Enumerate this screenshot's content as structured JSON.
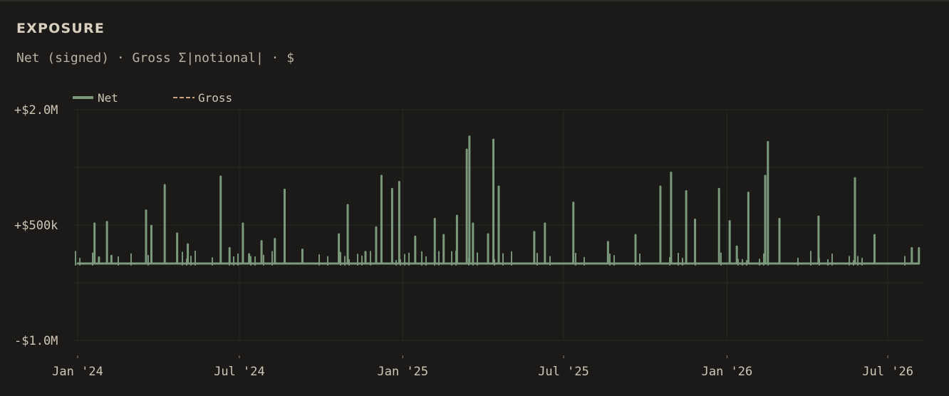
{
  "panel": {
    "title": "EXPOSURE",
    "subtitle": "Net (signed) · Gross Σ|notional| · $"
  },
  "colors": {
    "background": "#1b1a18",
    "grid": "#2a2926",
    "net": "#7b9a7c",
    "gross": "#c9a77a",
    "text": "#cfc6b6"
  },
  "chart_data": {
    "type": "line",
    "title": "EXPOSURE",
    "subtitle": "Net (signed) · Gross Σ|notional| · $",
    "legend": {
      "position": "top-left",
      "entries": [
        {
          "name": "Net",
          "style": "solid",
          "color": "#7b9a7c"
        },
        {
          "name": "Gross",
          "style": "dashed",
          "color": "#c9a77a"
        }
      ]
    },
    "y_ticks": [
      {
        "value": 2000000,
        "label": "+$2.0M"
      },
      {
        "value": 500000,
        "label": "+$500k"
      },
      {
        "value": -1000000,
        "label": "-$1.0M"
      }
    ],
    "x_ticks": [
      {
        "value": "2024-01-01",
        "label": "Jan '24"
      },
      {
        "value": "2024-07-01",
        "label": "Jul '24"
      },
      {
        "value": "2025-01-01",
        "label": "Jan '25"
      },
      {
        "value": "2025-07-01",
        "label": "Jul '25"
      },
      {
        "value": "2026-01-01",
        "label": "Jan '26"
      },
      {
        "value": "2026-07-01",
        "label": "Jul '26"
      }
    ],
    "xlim": [
      "2023-12-28",
      "2026-08-10"
    ],
    "ylim": [
      -1100000,
      2100000
    ],
    "grid": true,
    "baseline": 0,
    "series": [
      {
        "name": "Net",
        "points": [
          [
            "2024-01-01",
            0
          ],
          [
            "2024-01-20",
            520000
          ],
          [
            "2024-01-25",
            80000
          ],
          [
            "2024-02-03",
            540000
          ],
          [
            "2024-02-08",
            100000
          ],
          [
            "2024-03-18",
            690000
          ],
          [
            "2024-03-24",
            490000
          ],
          [
            "2024-04-08",
            1020000
          ],
          [
            "2024-04-22",
            390000
          ],
          [
            "2024-05-04",
            250000
          ],
          [
            "2024-06-10",
            1130000
          ],
          [
            "2024-06-20",
            200000
          ],
          [
            "2024-07-05",
            520000
          ],
          [
            "2024-07-12",
            120000
          ],
          [
            "2024-07-26",
            290000
          ],
          [
            "2024-08-10",
            320000
          ],
          [
            "2024-08-21",
            960000
          ],
          [
            "2024-09-10",
            180000
          ],
          [
            "2024-10-21",
            380000
          ],
          [
            "2024-10-31",
            760000
          ],
          [
            "2024-11-20",
            150000
          ],
          [
            "2024-12-02",
            470000
          ],
          [
            "2024-12-08",
            1140000
          ],
          [
            "2024-12-20",
            970000
          ],
          [
            "2024-12-28",
            1060000
          ],
          [
            "2025-01-15",
            350000
          ],
          [
            "2025-02-06",
            580000
          ],
          [
            "2025-02-16",
            370000
          ],
          [
            "2025-03-03",
            620000
          ],
          [
            "2025-03-14",
            1480000
          ],
          [
            "2025-03-17",
            1650000
          ],
          [
            "2025-03-21",
            520000
          ],
          [
            "2025-04-07",
            380000
          ],
          [
            "2025-04-13",
            1610000
          ],
          [
            "2025-04-19",
            1000000
          ],
          [
            "2025-05-29",
            410000
          ],
          [
            "2025-06-10",
            520000
          ],
          [
            "2025-07-12",
            790000
          ],
          [
            "2025-08-20",
            280000
          ],
          [
            "2025-09-20",
            370000
          ],
          [
            "2025-10-18",
            1000000
          ],
          [
            "2025-10-30",
            1180000
          ],
          [
            "2025-11-16",
            940000
          ],
          [
            "2025-11-26",
            570000
          ],
          [
            "2025-12-23",
            970000
          ],
          [
            "2026-01-04",
            550000
          ],
          [
            "2026-01-12",
            220000
          ],
          [
            "2026-01-25",
            920000
          ],
          [
            "2026-02-13",
            1140000
          ],
          [
            "2026-02-16",
            1580000
          ],
          [
            "2026-03-01",
            580000
          ],
          [
            "2026-04-14",
            610000
          ],
          [
            "2026-05-25",
            1110000
          ],
          [
            "2026-06-16",
            370000
          ],
          [
            "2026-07-28",
            200000
          ],
          [
            "2026-08-05",
            200000
          ]
        ]
      },
      {
        "name": "Gross",
        "points": []
      }
    ]
  }
}
